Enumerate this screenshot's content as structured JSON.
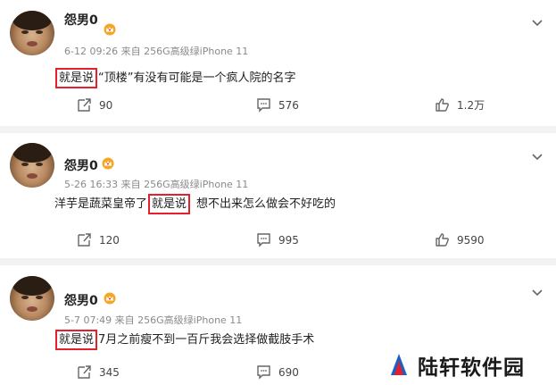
{
  "posts": [
    {
      "username": "怨男0",
      "meta": "6-12 09:26  来自 256G高级绿iPhone 11",
      "highlight": "就是说",
      "text_before": "",
      "text_after": "“顶楼”有没有可能是一个疯人院的名字",
      "repost_count": "90",
      "comment_count": "576",
      "like_count": "1.2万"
    },
    {
      "username": "怨男0",
      "meta": "5-26 16:33  来自 256G高级绿iPhone 11",
      "highlight": "就是说",
      "text_before": "洋芋是蔬菜皇帝了",
      "text_after": "想不出来怎么做会不好吃的",
      "repost_count": "120",
      "comment_count": "995",
      "like_count": "9590"
    },
    {
      "username": "怨男0",
      "meta": "5-7 07:49  来自 256G高级绿iPhone 11",
      "highlight": "就是说",
      "text_before": "",
      "text_after": "7月之前瘦不到一百斤我会选择做截肢手术",
      "repost_count": "345",
      "comment_count": "690",
      "like_count": ""
    }
  ],
  "watermark": {
    "text": "陆轩软件园"
  },
  "icons": {
    "badge": "vip-crown-icon",
    "repost": "repost-icon",
    "comment": "comment-icon",
    "like": "thumbs-up-icon",
    "menu": "chevron-down-icon",
    "logo": "watermark-logo-icon"
  },
  "colors": {
    "highlight_box": "#e3202b",
    "meta": "#8a8a8a",
    "badge": "#f5a623"
  }
}
